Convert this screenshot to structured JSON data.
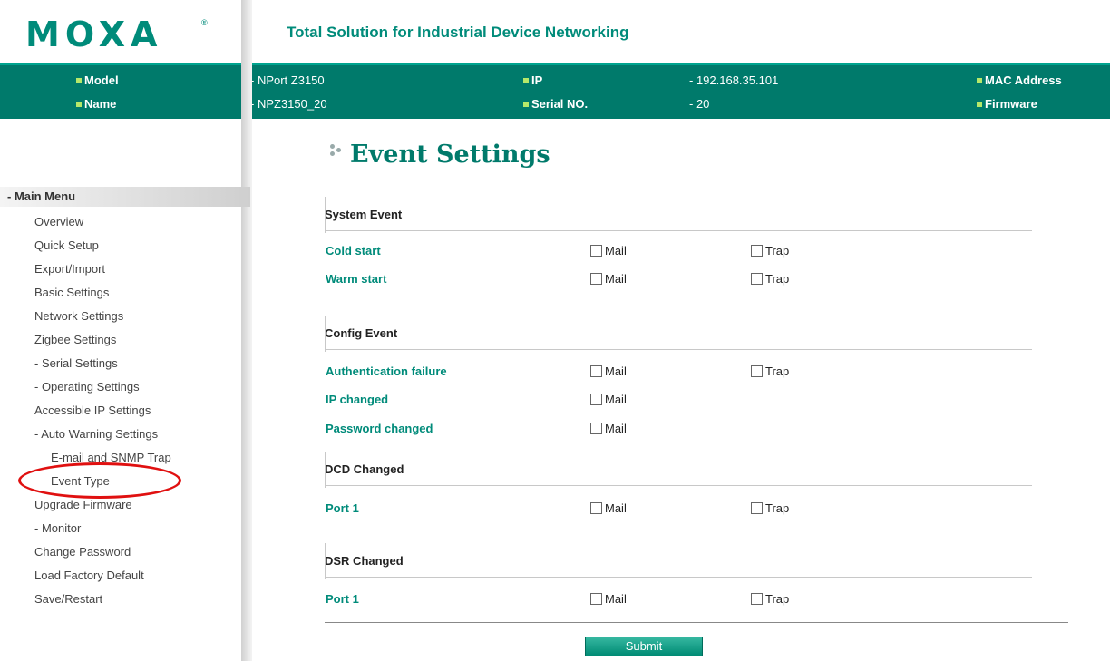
{
  "header": {
    "logo_text": "MOXA",
    "logo_mark": "®",
    "tagline": "Total Solution for Industrial Device Networking"
  },
  "info": {
    "model_label": "Model",
    "model_value": "- NPort Z3150",
    "name_label": "Name",
    "name_value": "- NPZ3150_20",
    "ip_label": "IP",
    "ip_value": "- 192.168.35.101",
    "serial_label": "Serial NO.",
    "serial_value": "- 20",
    "mac_label": "MAC Address",
    "firmware_label": "Firmware"
  },
  "sidebar": {
    "menu_header": "- Main Menu",
    "items": [
      "Overview",
      "Quick Setup",
      "Export/Import",
      "Basic Settings",
      "Network Settings",
      "Zigbee Settings",
      "- Serial Settings",
      "- Operating Settings",
      "Accessible IP Settings",
      "- Auto Warning Settings",
      "E-mail and SNMP Trap",
      "Event Type",
      "Upgrade Firmware",
      "- Monitor",
      "Change Password",
      "Load Factory Default",
      "Save/Restart"
    ]
  },
  "main": {
    "title": "Event Settings",
    "sections": [
      {
        "heading": "System Event",
        "rows": [
          {
            "label": "Cold start",
            "mail": "Mail",
            "trap": "Trap"
          },
          {
            "label": "Warm start",
            "mail": "Mail",
            "trap": "Trap"
          }
        ]
      },
      {
        "heading": "Config Event",
        "rows": [
          {
            "label": "Authentication failure",
            "mail": "Mail",
            "trap": "Trap"
          },
          {
            "label": "IP changed",
            "mail": "Mail"
          },
          {
            "label": "Password changed",
            "mail": "Mail"
          }
        ]
      },
      {
        "heading": "DCD Changed",
        "rows": [
          {
            "label": "Port 1",
            "mail": "Mail",
            "trap": "Trap"
          }
        ]
      },
      {
        "heading": "DSR Changed",
        "rows": [
          {
            "label": "Port 1",
            "mail": "Mail",
            "trap": "Trap"
          }
        ]
      }
    ],
    "submit_label": "Submit"
  },
  "colors": {
    "brand_teal": "#007a6b",
    "label_teal": "#008b7a",
    "bullet_green": "#b6e86a",
    "annotation_red": "#e01010"
  }
}
